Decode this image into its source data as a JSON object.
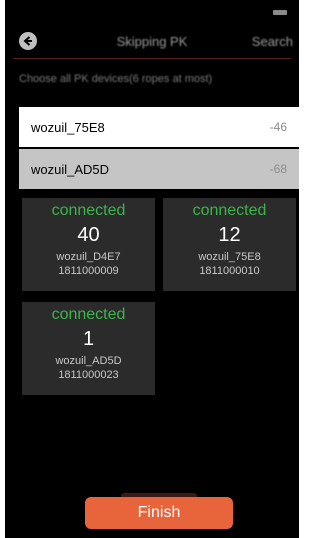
{
  "nav": {
    "back_icon": "back-arrow-icon",
    "title": "Skipping PK",
    "search_label": "Search"
  },
  "hint": "Choose all PK devices(6 ropes at most)",
  "devices": [
    {
      "name": "wozuil_75E8",
      "rssi": "-46",
      "selected": true
    },
    {
      "name": "wozuil_AD5D",
      "rssi": "-68",
      "selected": false
    }
  ],
  "cards": [
    {
      "status": "connected",
      "count": "40",
      "name": "wozuil_D4E7",
      "id": "1811000009"
    },
    {
      "status": "connected",
      "count": "12",
      "name": "wozuil_75E8",
      "id": "1811000010"
    },
    {
      "status": "connected",
      "count": "1",
      "name": "wozuil_AD5D",
      "id": "1811000023"
    }
  ],
  "finish_label": "Finish",
  "colors": {
    "accent": "#e8643a",
    "connected": "#39b54a",
    "background": "#000000",
    "card": "#2b2b2b"
  }
}
